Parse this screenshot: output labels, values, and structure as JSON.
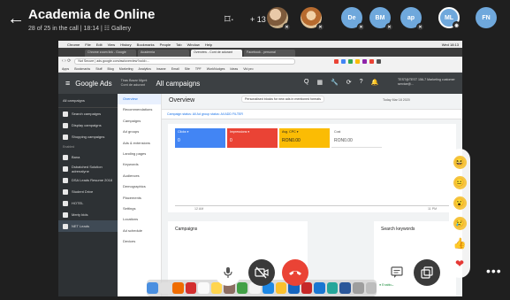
{
  "meeting": {
    "title": "Academia de Online",
    "subtitle": "28 of 25 in the call | 18:14 | ☷ Gallery",
    "more_participants": "+ 13",
    "participants": [
      {
        "initials": "",
        "kind": "photo"
      },
      {
        "initials": "",
        "kind": "photo"
      },
      {
        "initials": "De"
      },
      {
        "initials": "BM"
      },
      {
        "initials": "ap"
      },
      {
        "initials": "ML"
      },
      {
        "initials": "FN"
      }
    ]
  },
  "browser": {
    "mac_menu": [
      "Chrome",
      "File",
      "Edit",
      "View",
      "History",
      "Bookmarks",
      "People",
      "Tab",
      "Window",
      "Help"
    ],
    "mac_clock": "Wed 18:13",
    "tabs": [
      "Chrome zoom link - Google",
      "Academia",
      "Overview - Cont de adurant",
      "Facebook - personal"
    ],
    "url": "Not Secure | ads.google.com/aw/overview?ocid=...",
    "bookmarks": [
      "Apps",
      "Bookmarks",
      "Stuff",
      "Blog",
      "Marketing",
      "Analytics",
      "Insane",
      "Email",
      "Site",
      "TPF",
      "WorkNudges",
      "Ideas",
      "Vid pro"
    ]
  },
  "ads": {
    "logo": "Google Ads",
    "account": "Cont de adurant",
    "account_sub": "Tiras Bazar Mgmt",
    "page_title": "All campaigns",
    "tools": [
      "Q",
      "▦",
      "🔧",
      "⟳",
      "?",
      "🔔"
    ],
    "user": "TEST@TEST 156-7 Marketing customer service@...",
    "sidebar_head": "All campaigns",
    "sidebar_items": [
      "Search campaigns",
      "Display campaigns",
      "Shopping campaigns"
    ],
    "sidebar_section": "Enabled",
    "sidebar_items2": [
      "Bana",
      "Dsbatched Solution adrenalyne",
      "DSA Leads Resume 2018",
      "Student Drive",
      "HOTEL",
      "Merty bids",
      "NET Leads"
    ],
    "nav": [
      "Overview",
      "Recommendations",
      "Campaigns",
      "Ad groups",
      "Ads & extensions",
      "Landing pages",
      "Keywords",
      "Audiences",
      "Demographics",
      "Placements",
      "Settings",
      "Locations",
      "Ad schedule",
      "Devices"
    ],
    "overview_title": "Overview",
    "tooltip": "Personalised blocks for new ads in mentioned formats",
    "date_range": "Today Mar 18 2020",
    "filter": "Campaign status: All  Ad group status: All   ADD FILTER",
    "metrics": [
      {
        "name": "Clicks ▾",
        "value": "0"
      },
      {
        "name": "Impressions ▾",
        "value": "0"
      },
      {
        "name": "Avg. CPC ▾",
        "value": "RON0.00"
      },
      {
        "name": "Cost",
        "value": "RON0.00"
      }
    ],
    "axis_left": "12 AM",
    "axis_right": "11 PM",
    "card_campaigns": "Campaigns",
    "card_keywords": "Search keywords",
    "status_enabled": "● Enabled"
  },
  "controls": {
    "mic": "🎤",
    "camera": "📷",
    "end": "📞",
    "chat": "💬",
    "share": "⧉",
    "more": "•••"
  },
  "reactions": [
    "😆",
    "😐",
    "😮",
    "😢",
    "👍",
    "❤"
  ]
}
